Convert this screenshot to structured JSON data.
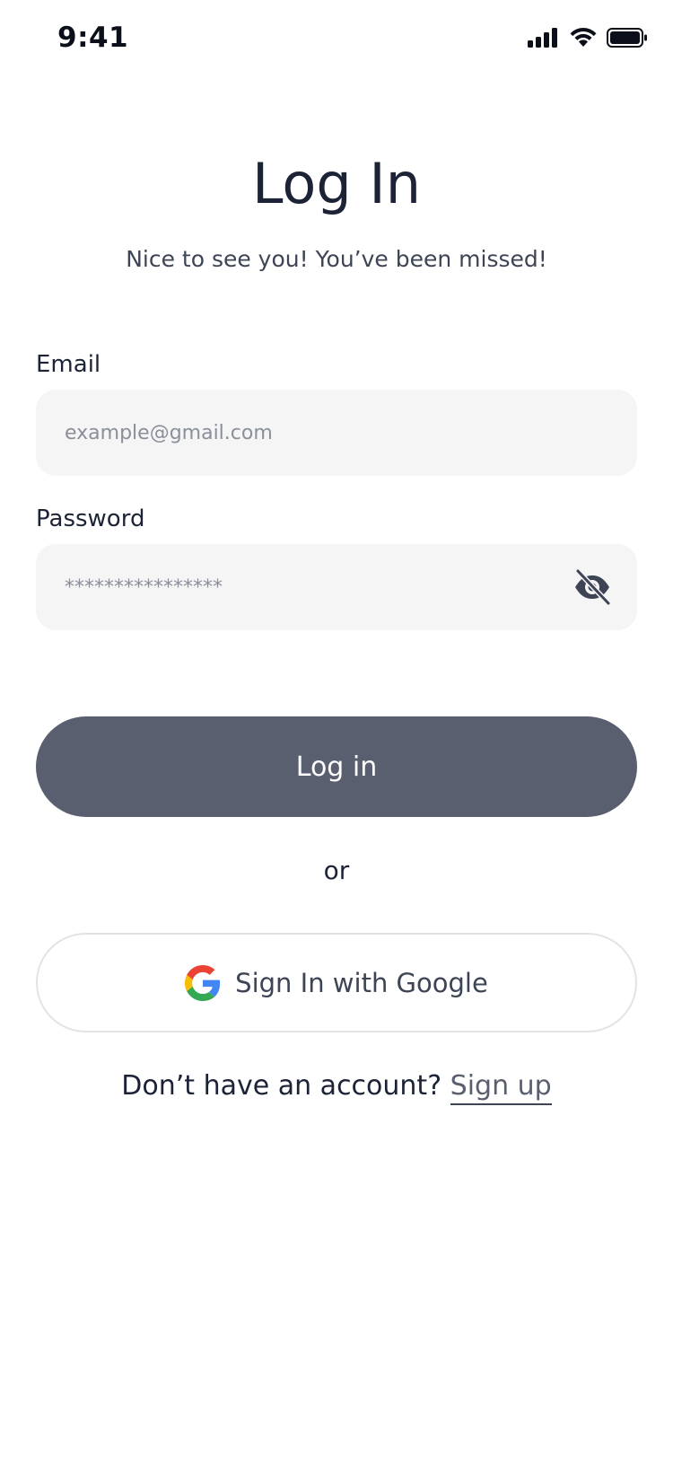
{
  "status_bar": {
    "time": "9:41",
    "icons": [
      "signal-icon",
      "wifi-icon",
      "battery-icon"
    ]
  },
  "header": {
    "title": "Log In",
    "subtitle": "Nice to see you! You’ve been missed!"
  },
  "form": {
    "email": {
      "label": "Email",
      "placeholder": "example@gmail.com",
      "value": ""
    },
    "password": {
      "label": "Password",
      "placeholder": "****************",
      "value": "",
      "toggle_icon": "eye-off-icon"
    },
    "login_label": "Log in"
  },
  "divider_text": "or",
  "google": {
    "label": "Sign In with Google",
    "icon": "google-logo-icon"
  },
  "signup": {
    "prompt": "Don’t have an account?",
    "link_label": "Sign up"
  },
  "colors": {
    "primary_button": "#5a5f6f",
    "text_dark": "#1c2336",
    "field_bg": "#f5f5f6",
    "border": "#e2e3e6"
  }
}
